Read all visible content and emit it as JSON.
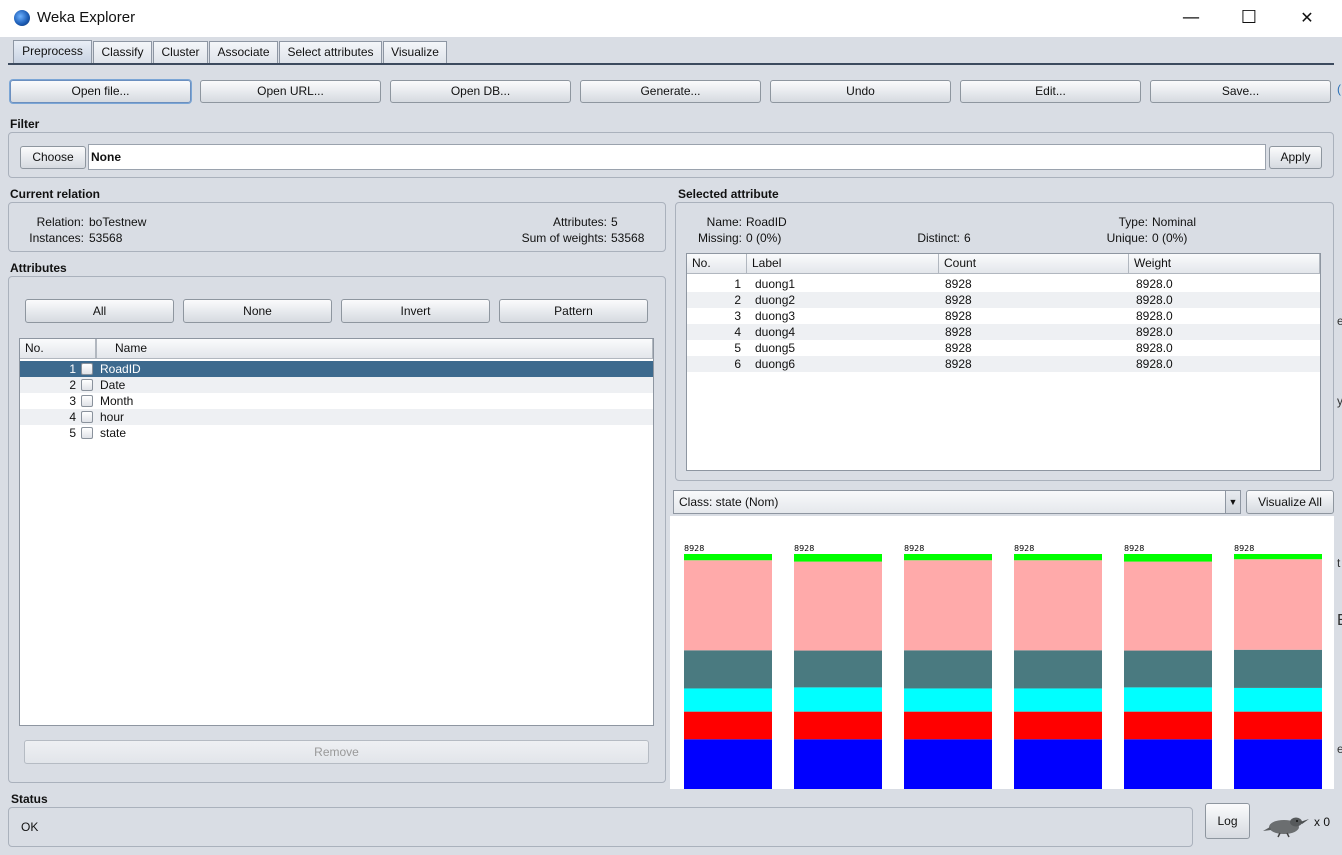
{
  "window": {
    "title": "Weka Explorer",
    "minimize": "—",
    "maximize": "☐",
    "close": "✕"
  },
  "tabs": [
    "Preprocess",
    "Classify",
    "Cluster",
    "Associate",
    "Select attributes",
    "Visualize"
  ],
  "toolbar": [
    "Open file...",
    "Open URL...",
    "Open DB...",
    "Generate...",
    "Undo",
    "Edit...",
    "Save..."
  ],
  "filter": {
    "label": "Filter",
    "choose": "Choose",
    "value": "None",
    "apply": "Apply"
  },
  "current_relation": {
    "label": "Current relation",
    "relation_key": "Relation:",
    "relation_val": "boTestnew",
    "instances_key": "Instances:",
    "instances_val": "53568",
    "attributes_key": "Attributes:",
    "attributes_val": "5",
    "weights_key": "Sum of weights:",
    "weights_val": "53568"
  },
  "attributes": {
    "label": "Attributes",
    "buttons": [
      "All",
      "None",
      "Invert",
      "Pattern"
    ],
    "headers": [
      "No.",
      "Name"
    ],
    "rows": [
      {
        "no": "1",
        "name": "RoadID"
      },
      {
        "no": "2",
        "name": "Date"
      },
      {
        "no": "3",
        "name": "Month"
      },
      {
        "no": "4",
        "name": "hour"
      },
      {
        "no": "5",
        "name": "state"
      }
    ],
    "selected_index": 0,
    "remove": "Remove"
  },
  "selected_attribute": {
    "label": "Selected attribute",
    "name_key": "Name:",
    "name_val": "RoadID",
    "missing_key": "Missing:",
    "missing_val": "0 (0%)",
    "distinct_key": "Distinct:",
    "distinct_val": "6",
    "type_key": "Type:",
    "type_val": "Nominal",
    "unique_key": "Unique:",
    "unique_val": "0 (0%)",
    "headers": [
      "No.",
      "Label",
      "Count",
      "Weight"
    ],
    "rows": [
      {
        "no": "1",
        "label": "duong1",
        "count": "8928",
        "weight": "8928.0"
      },
      {
        "no": "2",
        "label": "duong2",
        "count": "8928",
        "weight": "8928.0"
      },
      {
        "no": "3",
        "label": "duong3",
        "count": "8928",
        "weight": "8928.0"
      },
      {
        "no": "4",
        "label": "duong4",
        "count": "8928",
        "weight": "8928.0"
      },
      {
        "no": "5",
        "label": "duong5",
        "count": "8928",
        "weight": "8928.0"
      },
      {
        "no": "6",
        "label": "duong6",
        "count": "8928",
        "weight": "8928.0"
      }
    ]
  },
  "class_selector": {
    "value": "Class: state (Nom)",
    "visualize_all": "Visualize All"
  },
  "status": {
    "label": "Status",
    "text": "OK",
    "log": "Log",
    "tasks": "x 0"
  },
  "edge_marks": [
    "(",
    "e",
    "y",
    "t",
    "E",
    "e"
  ],
  "colors": {
    "selected_row": "#3d6a8e",
    "class_segments": [
      "#0000ff",
      "#ff0000",
      "#00ffff",
      "#4a7a80",
      "#ffaaaa",
      "#00ff00"
    ]
  },
  "chart_data": {
    "type": "bar",
    "stacked": true,
    "categories": [
      "duong1",
      "duong2",
      "duong3",
      "duong4",
      "duong5",
      "duong6"
    ],
    "data_labels": [
      "8928",
      "8928",
      "8928",
      "8928",
      "8928",
      "8928"
    ],
    "totals": [
      8928,
      8928,
      8928,
      8928,
      8928,
      8928
    ],
    "series": [
      {
        "color": "#0000ff",
        "values": [
          1890,
          1890,
          1890,
          1890,
          1890,
          1890
        ]
      },
      {
        "color": "#ff0000",
        "values": [
          1050,
          1050,
          1050,
          1050,
          1050,
          1050
        ]
      },
      {
        "color": "#00ffff",
        "values": [
          880,
          920,
          880,
          880,
          920,
          900
        ]
      },
      {
        "color": "#4a7a80",
        "values": [
          1450,
          1400,
          1450,
          1450,
          1400,
          1450
        ]
      },
      {
        "color": "#ffaaaa",
        "values": [
          3420,
          3380,
          3420,
          3420,
          3380,
          3440
        ]
      },
      {
        "color": "#00ff00",
        "values": [
          238,
          288,
          238,
          238,
          288,
          198
        ]
      }
    ]
  }
}
